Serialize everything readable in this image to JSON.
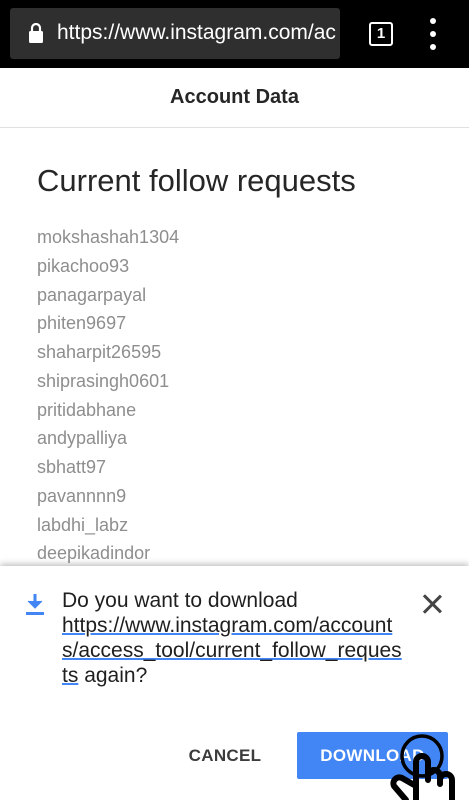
{
  "browser": {
    "url": "https://www.instagram.com/accounts/access_tool/current_follow_requests",
    "tab_count": "1",
    "lock_icon": "lock-icon",
    "menu_icon": "more-vert-icon"
  },
  "page": {
    "header_title": "Account Data",
    "section_title": "Current follow requests",
    "follow_requests": [
      "mokshashah1304",
      "pikachoo93",
      "panagarpayal",
      "phiten9697",
      "shaharpit26595",
      "shiprasingh0601",
      "pritidabhane",
      "andypalliya",
      "sbhatt97",
      "pavannnn9",
      "labdhi_labz",
      "deepikadindor"
    ]
  },
  "download_prompt": {
    "icon": "download-icon",
    "question_prefix": "Do you want to download",
    "link_text": "https://www.instagram.com/accounts/access_tool/current_follow_requests",
    "question_suffix": "again?",
    "cancel_label": "CANCEL",
    "download_label": "DOWNLOAD",
    "accent_color": "#4285f4"
  }
}
